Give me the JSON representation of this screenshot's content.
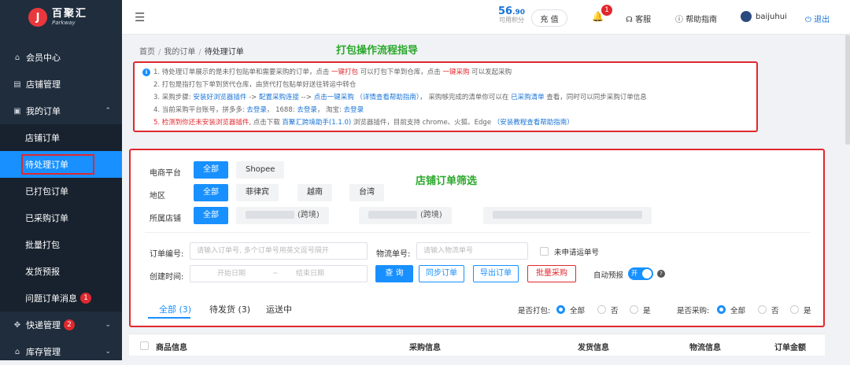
{
  "logo": {
    "mark": "J",
    "name_cn": "百聚汇",
    "name_en": "Parkway"
  },
  "sidebar": {
    "items": [
      {
        "label": "会员中心",
        "icon": "home-icon"
      },
      {
        "label": "店铺管理",
        "icon": "store-icon"
      },
      {
        "label": "我的订单",
        "icon": "order-icon"
      }
    ],
    "sub_items": [
      "店铺订单",
      "待处理订单",
      "已打包订单",
      "已采购订单",
      "批量打包",
      "发货预报",
      "问题订单消息"
    ],
    "problem_badge": "1",
    "express_label": "快递管理",
    "express_badge": "2",
    "inventory_label": "库存管理"
  },
  "topbar": {
    "points_int": "56",
    "points_dec": ".90",
    "points_label": "可用积分",
    "recharge": "充 值",
    "bell_badge": "1",
    "service": "客服",
    "help": "帮助指南",
    "username": "baijuhui",
    "logout": "退出"
  },
  "breadcrumb": [
    "首页",
    "我的订单",
    "待处理订单"
  ],
  "guide_title": "打包操作流程指导",
  "info": {
    "l1a": "1. 待处理订单展示的是未打包贴单和需要采购的订单，点击 ",
    "l1b": "一键打包",
    "l1c": " 可以打包下单到仓库，点击 ",
    "l1d": "一键采购",
    "l1e": " 可以发起采购",
    "l2": "2. 打包是指打包下单到货代仓库，由货代打包贴单好送往转运中转仓",
    "l3a": "3. 采购步骤: ",
    "l3b": "安装好浏览器插件",
    "l3c": " -> ",
    "l3d": "配置采购连接",
    "l3e": " --> ",
    "l3f": "点击一键采购",
    "l3g": " （详情查看帮助指南）",
    "l3h": "， 采购够完成的清单你可以在 ",
    "l3i": "已采购清单",
    "l3j": " 查看，同时可以同步采购订单信息",
    "l4a": "4. 当前采购平台账号，拼多多: ",
    "l4b": "去登录",
    "l4c": "， 1688: ",
    "l4d": "去登录",
    "l4e": "， 淘宝: ",
    "l4f": "去登录",
    "l5a": "5. 检测到你还未安装浏览器插件,",
    "l5b": " 点击下载 ",
    "l5c": "百聚汇跨境助手(1.1.0)",
    "l5d": " 浏览器插件，目前支持 chrome、火狐、Edge",
    "l5e": " （安装教程查看帮助指南）"
  },
  "filter": {
    "title": "店铺订单筛选",
    "platform_label": "电商平台",
    "platform_options": [
      "全部",
      "Shopee"
    ],
    "region_label": "地区",
    "region_options": [
      "全部",
      "菲律宾",
      "越南",
      "台湾"
    ],
    "shop_label": "所属店铺",
    "shop_all": "全部",
    "shop_suffix_1": "(跨境)",
    "shop_suffix_2": "(跨境)",
    "order_no_label": "订单编号:",
    "order_no_placeholder": "请输入订单号, 多个订单号用英文逗号隔开",
    "logistics_label": "物流单号:",
    "logistics_placeholder": "请输入物流单号",
    "no_waybill_label": "未申请运单号",
    "created_label": "创建时间:",
    "start_date": "开始日期",
    "date_sep": "~",
    "end_date": "结束日期",
    "btn_search": "查 询",
    "btn_sync": "同步订单",
    "btn_export": "导出订单",
    "btn_bulk_purchase": "批量采购",
    "auto_forecast_label": "自动预报",
    "toggle_on": "开",
    "help_mark": "?"
  },
  "tabs": [
    {
      "label": "全部",
      "count": "(3)"
    },
    {
      "label": "待发货",
      "count": "(3)"
    },
    {
      "label": "运送中",
      "count": ""
    }
  ],
  "packed_filter": {
    "label": "是否打包:",
    "options": [
      "全部",
      "否",
      "是"
    ]
  },
  "purchased_filter": {
    "label": "是否采购:",
    "options": [
      "全部",
      "否",
      "是"
    ]
  },
  "table": {
    "headers": [
      "商品信息",
      "采购信息",
      "发货信息",
      "物流信息",
      "订单金额"
    ]
  }
}
